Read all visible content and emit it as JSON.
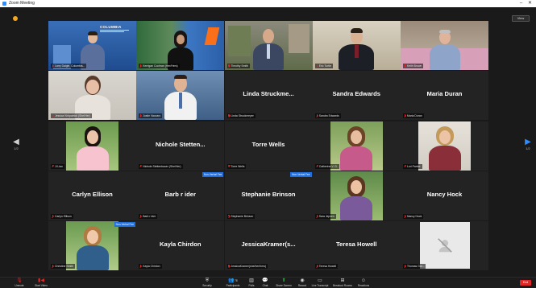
{
  "window": {
    "title": "Zoom Meeting",
    "minimize": "–",
    "close": "✕"
  },
  "view": {
    "label": "View"
  },
  "paging": {
    "left_page": "1/2",
    "right_page": "1/2"
  },
  "colors": {
    "active_speaker": "#8fd42a",
    "muted": "#e02828",
    "accent": "#2d8cff",
    "share": "#2ab24a"
  },
  "tiles": [
    {
      "type": "video",
      "label": "Larry Daigle, Columbia...",
      "badge": ""
    },
    {
      "type": "video",
      "label": "Kerrigan Cochran (Her/Hers)",
      "badge": ""
    },
    {
      "type": "video",
      "label": "Timothy Smith",
      "badge": ""
    },
    {
      "type": "video",
      "label": "Eric Turtle",
      "badge": ""
    },
    {
      "type": "video",
      "label": "Keith Brown",
      "badge": ""
    },
    {
      "type": "video",
      "label": "Jessica Kirkpatrick (She/Her)",
      "badge": ""
    },
    {
      "type": "video",
      "label": "Justin Vaccaro",
      "badge": ""
    },
    {
      "type": "name",
      "name": "Linda  Struckme...",
      "label": "Linda Struckmeyer",
      "badge": ""
    },
    {
      "type": "name",
      "name": "Sandra Edwards",
      "label": "Sandra Edwards",
      "badge": ""
    },
    {
      "type": "name",
      "name": "Maria Duran",
      "label": "Maria Duran",
      "badge": ""
    },
    {
      "type": "video",
      "label": "Ji Liao",
      "badge": ""
    },
    {
      "type": "name",
      "name": "Nichole  Stetten...",
      "label": "Nichole Stettenbauer (She/Her)",
      "badge": ""
    },
    {
      "type": "name",
      "name": "Torre Wells",
      "label": "Torre Wells",
      "badge": ""
    },
    {
      "type": "video",
      "label": "Catherine V. G.",
      "badge": ""
    },
    {
      "type": "video",
      "label": "Lori Parker",
      "badge": ""
    },
    {
      "type": "name",
      "name": "Carlyn Ellison",
      "label": "Carlyn Ellison",
      "badge": ""
    },
    {
      "type": "name",
      "name": "Barb r ider",
      "label": "Barb r ider",
      "badge": "Non-Verbal Fee"
    },
    {
      "type": "name",
      "name": "Stephanie Brinson",
      "label": "Stephanie Brinson",
      "badge": "Non-Verbal Fee"
    },
    {
      "type": "video",
      "label": "Sara Jepsen",
      "badge": ""
    },
    {
      "type": "name",
      "name": "Nancy Hock",
      "label": "Nancy Hock",
      "badge": ""
    },
    {
      "type": "video",
      "label": "Christine Smith",
      "badge": "Non-Verbal Fee"
    },
    {
      "type": "name",
      "name": "Kayla Chirdon",
      "label": "Kayla Chirdon",
      "badge": ""
    },
    {
      "type": "name",
      "name": "JessicaKramer(s...",
      "label": "JessicaKramer(she/her/hers)",
      "badge": ""
    },
    {
      "type": "name",
      "name": "Teresa Howell",
      "label": "Teresa Howell",
      "badge": ""
    },
    {
      "type": "off",
      "label": "Thomas Gar...",
      "badge": ""
    }
  ],
  "toolbar": {
    "mute": "Unmute",
    "video": "Start Video",
    "security": "Security",
    "participants": "Participants",
    "participants_count": "78",
    "polls": "Polls",
    "chat": "Chat",
    "share": "Share Screen",
    "record": "Record",
    "cc": "Live Transcript",
    "breakout": "Breakout Rooms",
    "reactions": "Reactions",
    "end": "End"
  }
}
